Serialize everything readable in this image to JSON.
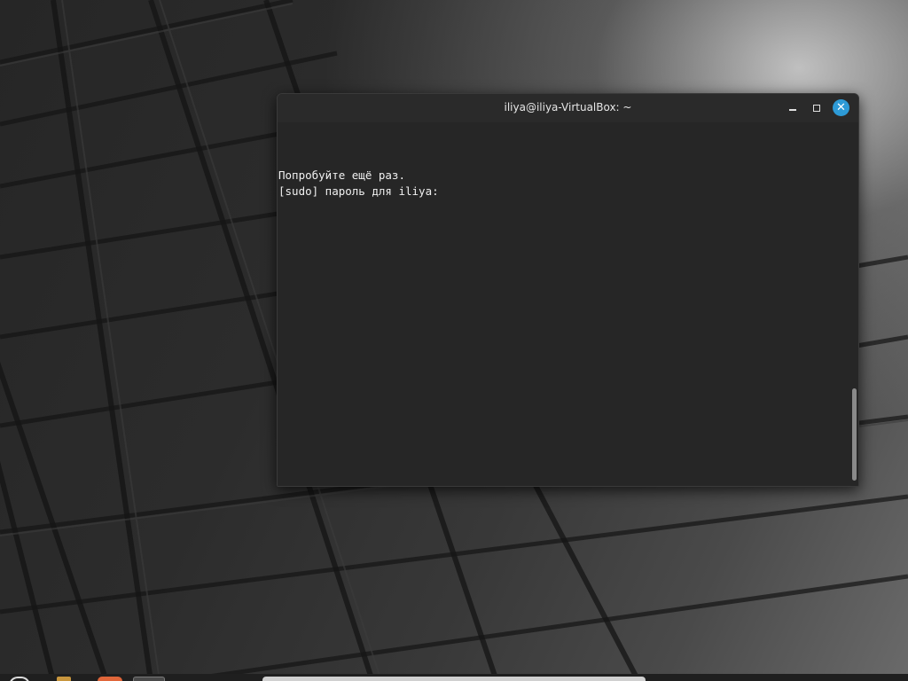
{
  "window": {
    "title": "iliya@iliya-VirtualBox: ~",
    "minimize_icon": "minimize-icon",
    "maximize_icon": "maximize-icon",
    "close_icon": "close-icon",
    "close_glyph": "✕",
    "close_color": "#2d9ad6"
  },
  "terminal": {
    "lines": [
      "Попробуйте ещё раз.",
      "[sudo] пароль для iliya:"
    ],
    "background": "#262626",
    "text_color": "#f0f0f0"
  },
  "taskbar": {
    "items": [
      {
        "name": "menu-icon"
      },
      {
        "name": "files-icon"
      },
      {
        "name": "firefox-icon"
      },
      {
        "name": "terminal-icon"
      },
      {
        "name": "window-list-button"
      }
    ]
  }
}
